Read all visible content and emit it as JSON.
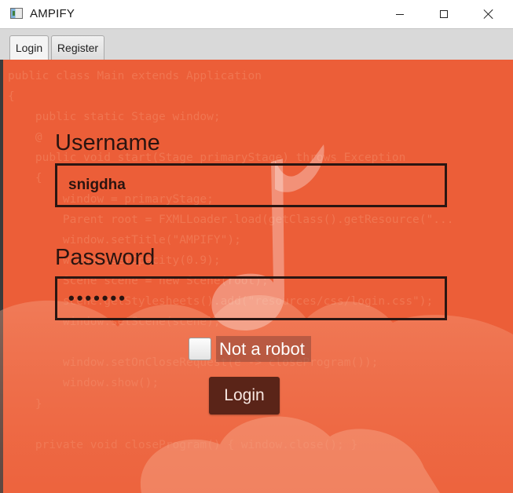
{
  "window": {
    "title": "AMPIFY",
    "icon": "java-app-icon",
    "controls": [
      "minimize-icon",
      "maximize-icon",
      "close-icon"
    ]
  },
  "tabs": [
    {
      "label": "Login",
      "selected": true
    },
    {
      "label": "Register",
      "selected": false
    }
  ],
  "form": {
    "username_label": "Username",
    "username_value": "snigdha",
    "password_label": "Password",
    "password_value": "•••••••",
    "robot_label": "Not a robot",
    "robot_checked": false,
    "login_button": "Login"
  },
  "background": {
    "code_lines": [
      "public class Main extends Application",
      "{",
      "    public static Stage window;",
      "    @",
      "    public void start(Stage primaryStage) throws Exception",
      "    {",
      "        window = primaryStage;",
      "        Parent root = FXMLLoader.load(getClass().getResource(\"...",
      "        window.setTitle(\"AMPIFY\");",
      "        window.setOpacity(0.9);",
      "        Scene scene = new Scene(root);",
      "        scene.getStylesheets().add(\"resources/css/login.css\");",
      "        window.setScene(scene);",
      "",
      "        window.setOnCloseRequest(e -> closeProgram());",
      "        window.show();",
      "    }",
      "",
      "    private void closeProgram() { window.close(); }"
    ],
    "decoration": "music-note-icon",
    "colors": {
      "panel": "#ec5e38",
      "cloud": "#f49a7c",
      "text_dark": "#2a1410",
      "button": "#5a2418"
    }
  }
}
